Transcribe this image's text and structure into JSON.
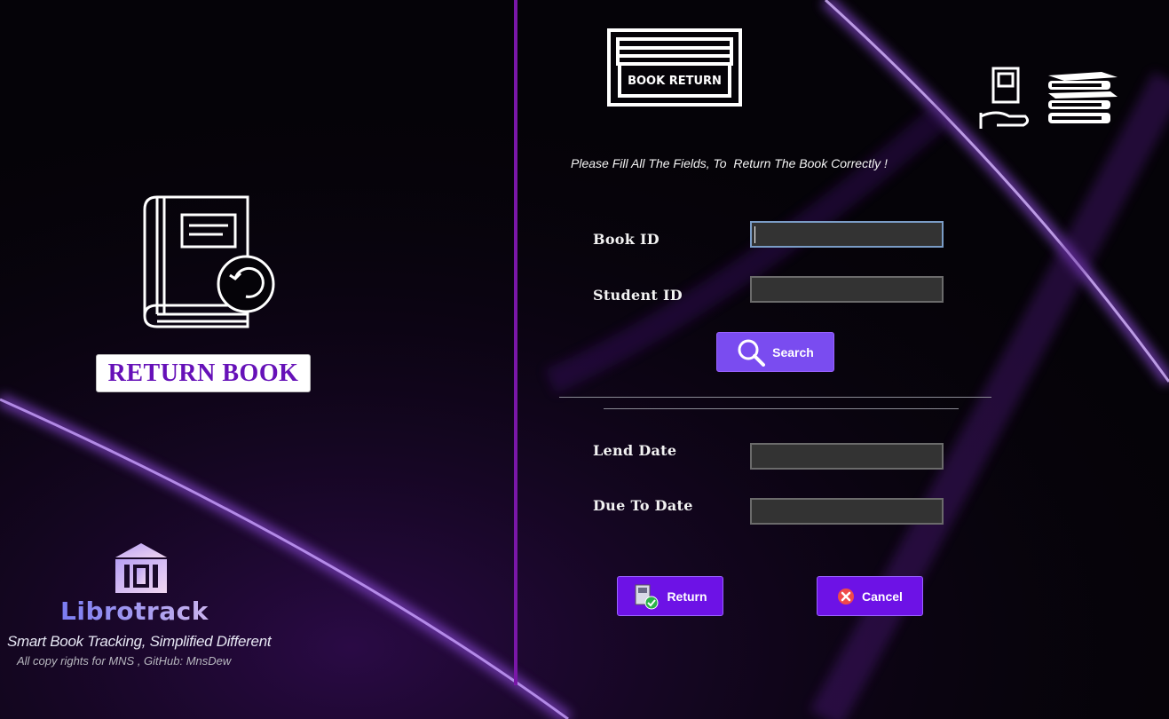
{
  "left_panel": {
    "return_book_label": "RETURN BOOK",
    "icon": "book-return-icon"
  },
  "branding": {
    "app_name": "Librotrack",
    "tagline": "Smart Book Tracking, Simplified Different",
    "copyright": "All copy rights for MNS , GitHub: MnsDew",
    "logo_icon": "library-building-icon"
  },
  "header": {
    "banner_text": "BOOK RETURN",
    "decor_icon": "books-stack-icon"
  },
  "form": {
    "instruction": "Please Fill All The Fields, To  Return The Book Correctly !",
    "book_id": {
      "label": "Book ID",
      "value": ""
    },
    "student_id": {
      "label": "Student ID",
      "value": ""
    },
    "search_button": "Search",
    "lend_date": {
      "label": "Lend Date",
      "value": ""
    },
    "due_date": {
      "label": "Due To Date",
      "value": ""
    },
    "return_button": "Return",
    "cancel_button": "Cancel"
  },
  "colors": {
    "accent": "#6d12e6",
    "label_purple": "#6611b8",
    "divider": "#7a17a8"
  }
}
